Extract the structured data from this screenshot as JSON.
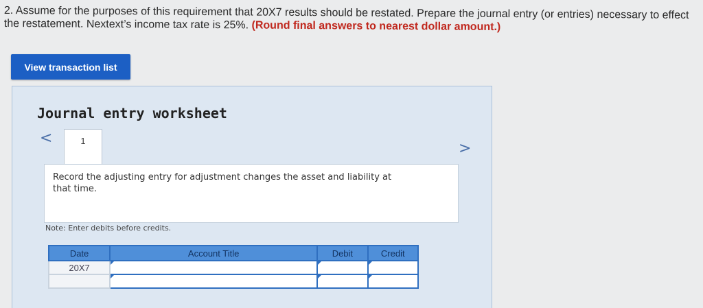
{
  "question": {
    "text": "2. Assume for the purposes of this requirement that 20X7 results should be restated. Prepare the journal entry (or entries) necessary to effect the restatement. Nextext’s income tax rate is 25%.",
    "emphasis": "(Round final answers to nearest dollar amount.)"
  },
  "toolbar": {
    "view_transactions_label": "View transaction list"
  },
  "worksheet": {
    "title": "Journal entry worksheet",
    "prev_symbol": "<",
    "next_symbol": ">",
    "tab_label": "1",
    "instruction": "Record the adjusting entry for adjustment changes the asset and liability at that time.",
    "note": "Note: Enter debits before credits."
  },
  "table": {
    "headers": {
      "date": "Date",
      "account": "Account Title",
      "debit": "Debit",
      "credit": "Credit"
    },
    "rows": [
      {
        "date": "20X7",
        "account": "",
        "debit": "",
        "credit": ""
      },
      {
        "date": "",
        "account": "",
        "debit": "",
        "credit": ""
      }
    ]
  },
  "colors": {
    "button": "#1c5fc4",
    "header": "#4f8fd9",
    "emphasis": "#c0281e"
  }
}
